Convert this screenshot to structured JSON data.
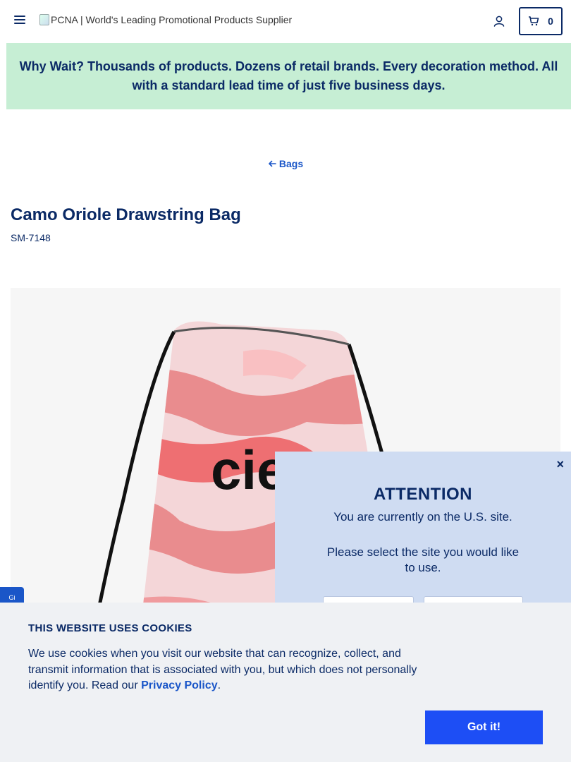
{
  "header": {
    "logo_alt": "PCNA | World's Leading Promotional Products Supplier",
    "cart_count": "0"
  },
  "promo": {
    "text": "Why Wait? Thousands of products. Dozens of retail brands. Every decoration method. All with a standard lead time of just five business days."
  },
  "breadcrumb": {
    "label": "Bags"
  },
  "product": {
    "title": "Camo Oriole Drawstring Bag",
    "sku": "SM-7148",
    "image_logo_text": "cie"
  },
  "side_tab": {
    "label": "Gi"
  },
  "attention_popup": {
    "close_label": "×",
    "title": "ATTENTION",
    "line1": "You are currently on the U.S. site.",
    "line2": "Please select the site you would like to use."
  },
  "cookie_banner": {
    "title": "THIS WEBSITE USES COOKIES",
    "text": "We use cookies when you visit our website that can recognize, collect, and transmit information that is associated with you, but which does not personally identify you. Read our ",
    "link_label": "Privacy Policy",
    "text_end": ".",
    "button_label": "Got it!"
  },
  "colors": {
    "navy": "#0b2a66",
    "link_blue": "#1a56c8",
    "promo_bg": "#c6eed4",
    "popup_bg": "#cfdcf2",
    "cookie_bg": "#eff1f4",
    "button_blue": "#1d4ef5"
  },
  "icons": {
    "menu": "hamburger-menu-icon",
    "account": "user-account-icon",
    "cart": "shopping-cart-icon",
    "back": "arrow-left-icon",
    "close": "close-icon"
  }
}
